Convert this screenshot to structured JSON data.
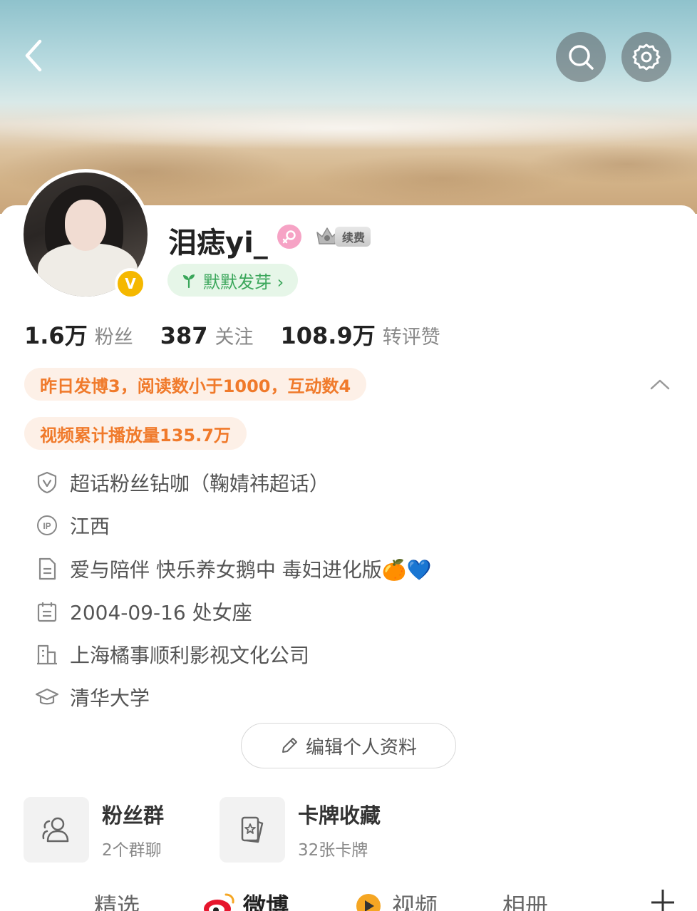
{
  "profile": {
    "username": "泪痣yi_",
    "vip_label": "续费",
    "sprout_label": "默默发芽 ›"
  },
  "stats": [
    {
      "num": "1.6万",
      "label": "粉丝"
    },
    {
      "num": "387",
      "label": "关注"
    },
    {
      "num": "108.9万",
      "label": "转评赞"
    }
  ],
  "highlights": {
    "line1": "昨日发博3，阅读数小于1000，互动数4",
    "line2": "视频累计播放量135.7万"
  },
  "info": [
    {
      "icon": "shield-v-icon",
      "text": "超话粉丝钻咖（鞠婧祎超话）"
    },
    {
      "icon": "ip-icon",
      "text": "江西"
    },
    {
      "icon": "document-icon",
      "text": "爱与陪伴 快乐养女鹅中 毒妇进化版🍊💙"
    },
    {
      "icon": "calendar-icon",
      "text": "2004-09-16 处女座"
    },
    {
      "icon": "building-icon",
      "text": "上海橘事顺利影视文化公司"
    },
    {
      "icon": "graduation-cap-icon",
      "text": "清华大学"
    }
  ],
  "edit_button": "编辑个人资料",
  "features": [
    {
      "title": "粉丝群",
      "sub": "2个群聊"
    },
    {
      "title": "卡牌收藏",
      "sub": "32张卡牌"
    }
  ],
  "tabs": [
    "精选",
    "微博",
    "视频",
    "相册"
  ],
  "colors": {
    "accent_orange": "#f07a2b",
    "sprout_green": "#3aa65a",
    "verified_gold": "#f5b800"
  }
}
